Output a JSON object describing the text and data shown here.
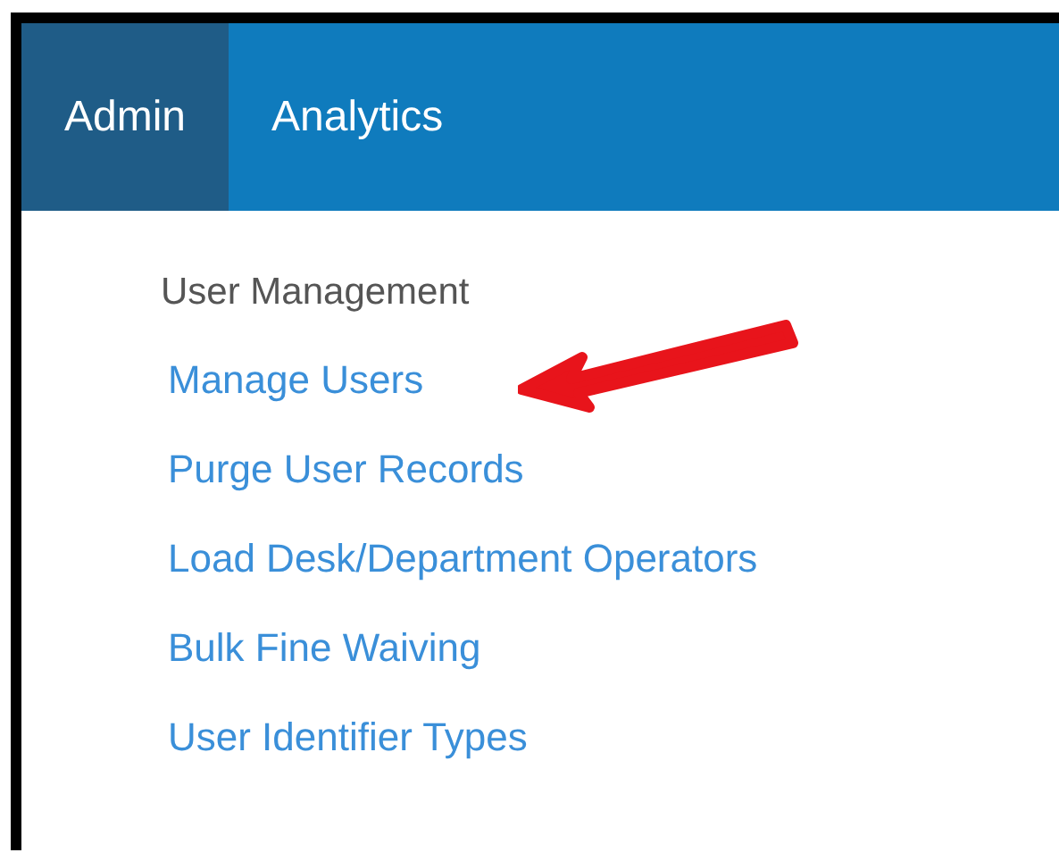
{
  "nav": {
    "tabs": [
      {
        "label": "Admin",
        "selected": true
      },
      {
        "label": "Analytics",
        "selected": false
      }
    ]
  },
  "menu": {
    "heading": "User Management",
    "links": [
      {
        "label": "Manage Users",
        "highlighted": true
      },
      {
        "label": "Purge User Records",
        "highlighted": false
      },
      {
        "label": "Load Desk/Department Operators",
        "highlighted": false
      },
      {
        "label": "Bulk Fine Waiving",
        "highlighted": false
      },
      {
        "label": "User Identifier Types",
        "highlighted": false
      }
    ]
  }
}
